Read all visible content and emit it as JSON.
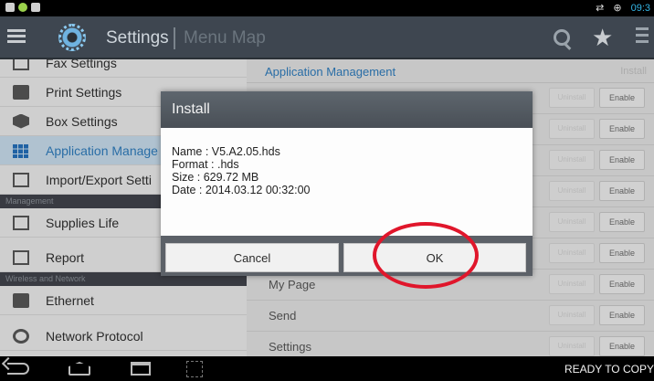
{
  "statusbar": {
    "time": "09:3"
  },
  "appbar": {
    "title": "Settings",
    "subtitle": "Menu Map"
  },
  "sidebar": {
    "items": [
      {
        "label": "Fax Settings"
      },
      {
        "label": "Print Settings"
      },
      {
        "label": "Box Settings"
      },
      {
        "label": "Application Manage"
      },
      {
        "label": "Import/Export Setti"
      },
      {
        "label": "Supplies Life"
      },
      {
        "label": "Report"
      },
      {
        "label": "Ethernet"
      },
      {
        "label": "Network Protocol"
      }
    ],
    "headers": [
      "Management",
      "Wireless and Network"
    ]
  },
  "main": {
    "header_title": "Application Management",
    "header_action": "Install",
    "rows": [
      {
        "label": "",
        "disable": "Uninstall",
        "enable": "Enable"
      },
      {
        "label": "",
        "disable": "Uninstall",
        "enable": "Enable"
      },
      {
        "label": "",
        "disable": "Uninstall",
        "enable": "Enable"
      },
      {
        "label": "",
        "disable": "Uninstall",
        "enable": "Enable"
      },
      {
        "label": "",
        "disable": "Uninstall",
        "enable": "Enable"
      },
      {
        "label": "",
        "disable": "Uninstall",
        "enable": "Enable"
      },
      {
        "label": "My Page",
        "disable": "Uninstall",
        "enable": "Enable"
      },
      {
        "label": "Send",
        "disable": "Uninstall",
        "enable": "Enable"
      },
      {
        "label": "Settings",
        "disable": "Uninstall",
        "enable": "Enable"
      }
    ]
  },
  "dialog": {
    "title": "Install",
    "lines": [
      "Name : V5.A2.05.hds",
      "Format : .hds",
      "Size : 629.72 MB",
      "Date : 2014.03.12 00:32:00"
    ],
    "cancel_label": "Cancel",
    "ok_label": "OK"
  },
  "navbar": {
    "status": "READY TO COPY"
  },
  "colors": {
    "accent": "#2a7dc2",
    "highlight": "#e0162b",
    "appbar": "#3e4650"
  }
}
